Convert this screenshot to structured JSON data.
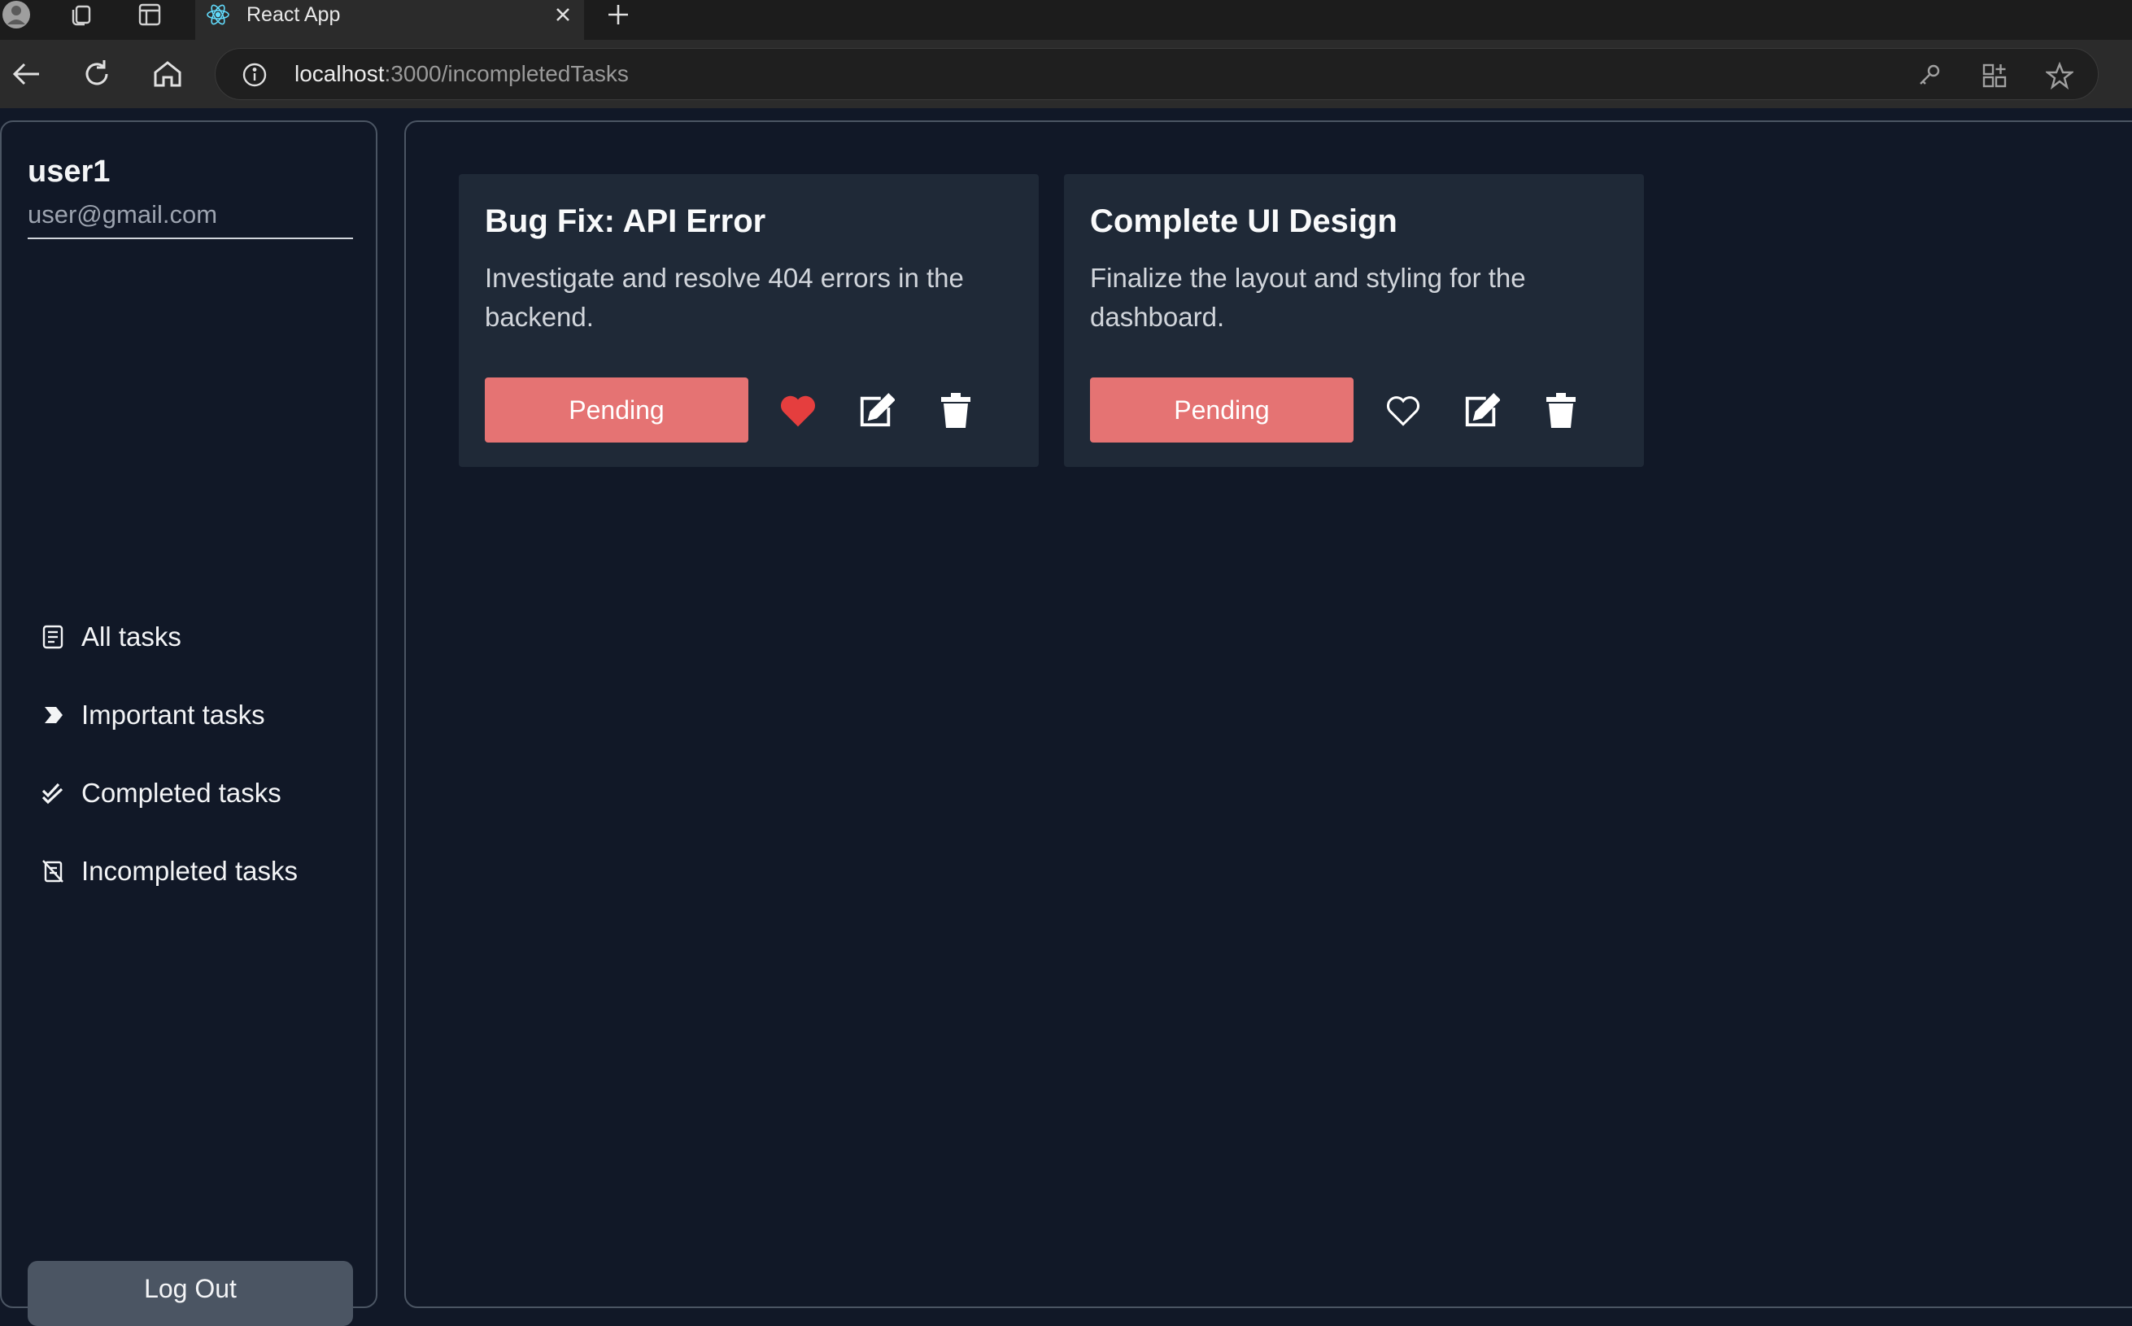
{
  "browser": {
    "tab_title": "React App",
    "url_host": "localhost",
    "url_path": ":3000/incompletedTasks",
    "icons": [
      "profile-icon",
      "workspaces-icon",
      "tab-actions-icon",
      "react-favicon-icon",
      "close-icon",
      "new-tab-icon",
      "back-icon",
      "refresh-icon",
      "home-icon",
      "site-info-icon",
      "password-key-icon",
      "apps-icon",
      "favorites-star-icon"
    ]
  },
  "user": {
    "name": "user1",
    "email": "user@gmail.com"
  },
  "sidebar": {
    "items": [
      {
        "label": "All tasks",
        "icon": "document-list-icon"
      },
      {
        "label": "Important tasks",
        "icon": "important-chevron-icon"
      },
      {
        "label": "Completed tasks",
        "icon": "double-check-icon"
      },
      {
        "label": "Incompleted tasks",
        "icon": "crossed-note-icon"
      }
    ],
    "logout_label": "Log Out"
  },
  "tasks": [
    {
      "title": "Bug Fix: API Error",
      "description": "Investigate and resolve 404 errors in the backend.",
      "status": "Pending",
      "favorite": true
    },
    {
      "title": "Complete UI Design",
      "description": "Finalize the layout and styling for the dashboard.",
      "status": "Pending",
      "favorite": false
    }
  ],
  "colors": {
    "background": "#111827",
    "card": "#1f2937",
    "pending": "#e57373",
    "favorite": "#e53e3e",
    "border": "#4b5563"
  }
}
